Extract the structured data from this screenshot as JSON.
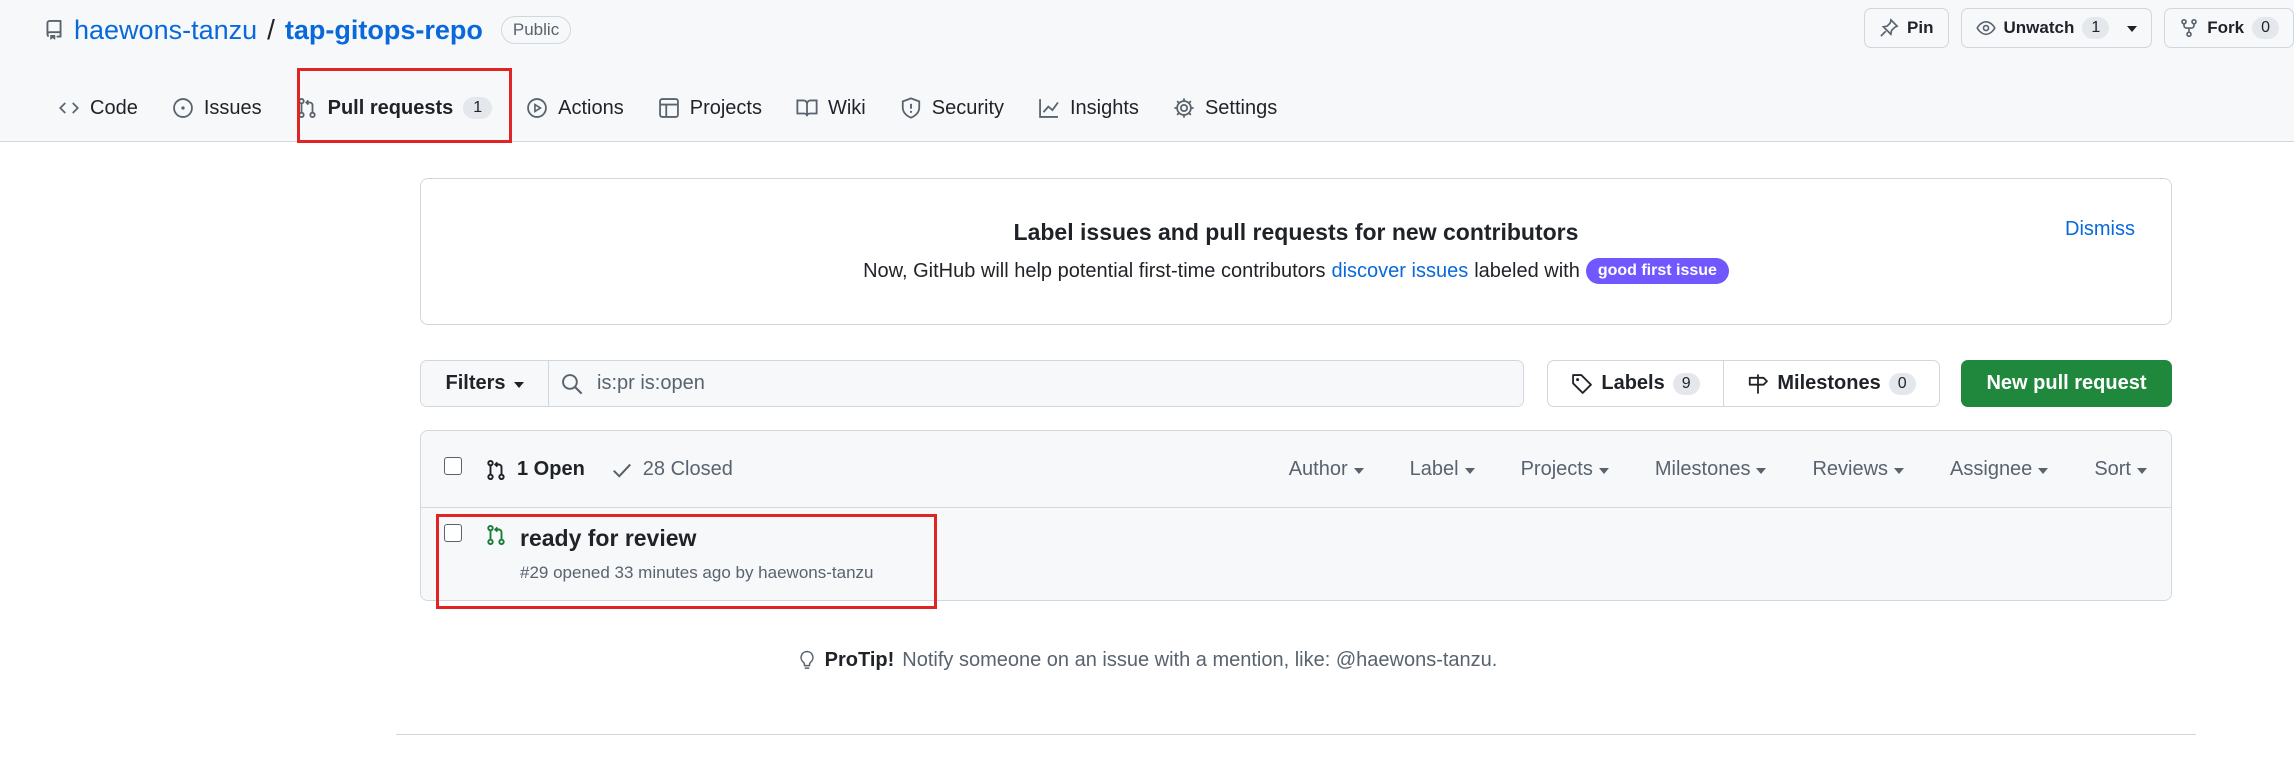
{
  "repo": {
    "owner": "haewons-tanzu",
    "separator": "/",
    "name": "tap-gitops-repo",
    "visibility": "Public"
  },
  "top_actions": {
    "pin": "Pin",
    "unwatch": "Unwatch",
    "unwatch_count": "1",
    "fork": "Fork",
    "fork_count": "0"
  },
  "tabs": [
    {
      "label": "Code",
      "icon": "code-icon"
    },
    {
      "label": "Issues",
      "icon": "issue-icon"
    },
    {
      "label": "Pull requests",
      "icon": "pull-request-icon",
      "count": "1",
      "selected": true
    },
    {
      "label": "Actions",
      "icon": "play-icon"
    },
    {
      "label": "Projects",
      "icon": "table-icon"
    },
    {
      "label": "Wiki",
      "icon": "book-icon"
    },
    {
      "label": "Security",
      "icon": "shield-icon"
    },
    {
      "label": "Insights",
      "icon": "graph-icon"
    },
    {
      "label": "Settings",
      "icon": "gear-icon"
    }
  ],
  "banner": {
    "title": "Label issues and pull requests for new contributors",
    "text_before": "Now, GitHub will help potential first-time contributors",
    "link": "discover issues",
    "text_after": "labeled with",
    "label": "good first issue",
    "dismiss": "Dismiss",
    "label_color": "#7057ff"
  },
  "filters": {
    "button": "Filters",
    "search_value": "is:pr is:open",
    "labels": "Labels",
    "labels_count": "9",
    "milestones": "Milestones",
    "milestones_count": "0",
    "new_pr": "New pull request",
    "new_pr_color": "#1f883d"
  },
  "list": {
    "open": "1 Open",
    "closed": "28 Closed",
    "sorts": [
      "Author",
      "Label",
      "Projects",
      "Milestones",
      "Reviews",
      "Assignee",
      "Sort"
    ],
    "items": [
      {
        "title": "ready for review",
        "meta": "#29 opened 33 minutes ago by haewons-tanzu"
      }
    ]
  },
  "protip": {
    "label": "ProTip!",
    "text": "Notify someone on an issue with a mention, like: @haewons-tanzu."
  },
  "accent_color": "#0969da",
  "highlight_color": "#e02424"
}
